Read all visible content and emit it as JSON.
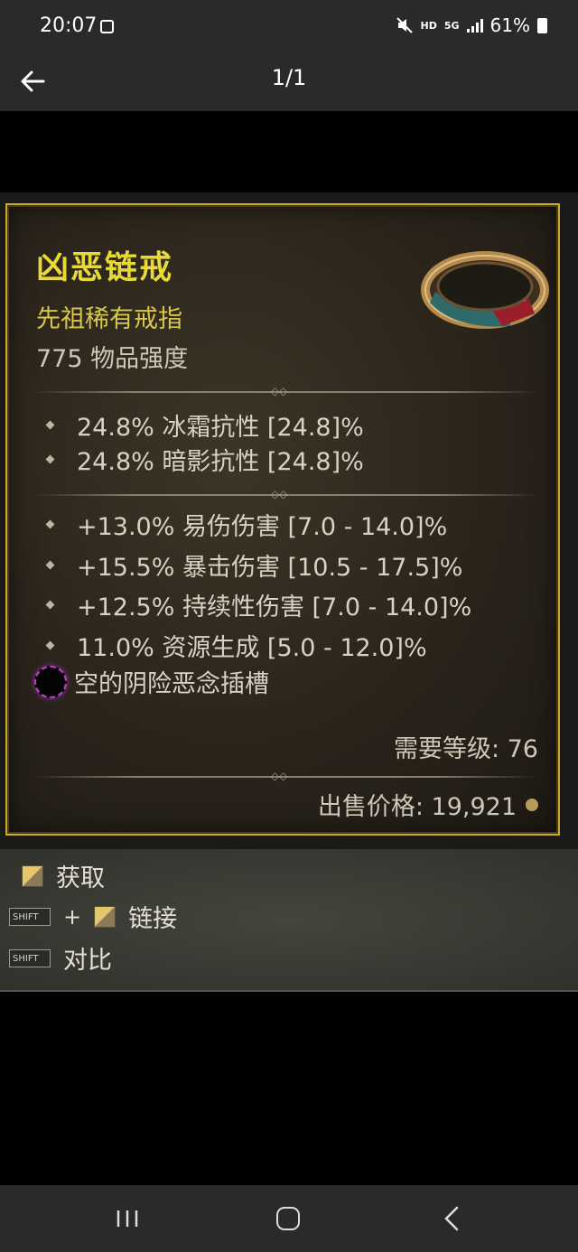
{
  "status_bar": {
    "time": "20:07",
    "network": "HD",
    "network_5g": "5G",
    "battery": "61%"
  },
  "app_bar": {
    "page_counter": "1/1"
  },
  "item": {
    "name": "凶恶链戒",
    "type": "先祖稀有戒指",
    "power": "775 物品强度",
    "implicit_stats": [
      "24.8% 冰霜抗性 [24.8]%",
      "24.8% 暗影抗性 [24.8]%"
    ],
    "affixes": [
      "+13.0% 易伤伤害 [7.0 - 14.0]%",
      "+15.5% 暴击伤害 [10.5 - 17.5]%",
      "+12.5% 持续性伤害 [7.0 - 14.0]%",
      "11.0% 资源生成 [5.0 - 12.0]%"
    ],
    "socket": "空的阴险恶念插槽",
    "required_level": "需要等级: 76",
    "sell_price": "出售价格: 19,921"
  },
  "actions": {
    "acquire": "获取",
    "shift_key": "SHIFT",
    "plus": "+",
    "link": "链接",
    "compare": "对比"
  },
  "colors": {
    "item_name": "#e8d838",
    "item_type": "#d8c84a",
    "border": "#c8a92c",
    "socket_glow": "#c040c8"
  }
}
